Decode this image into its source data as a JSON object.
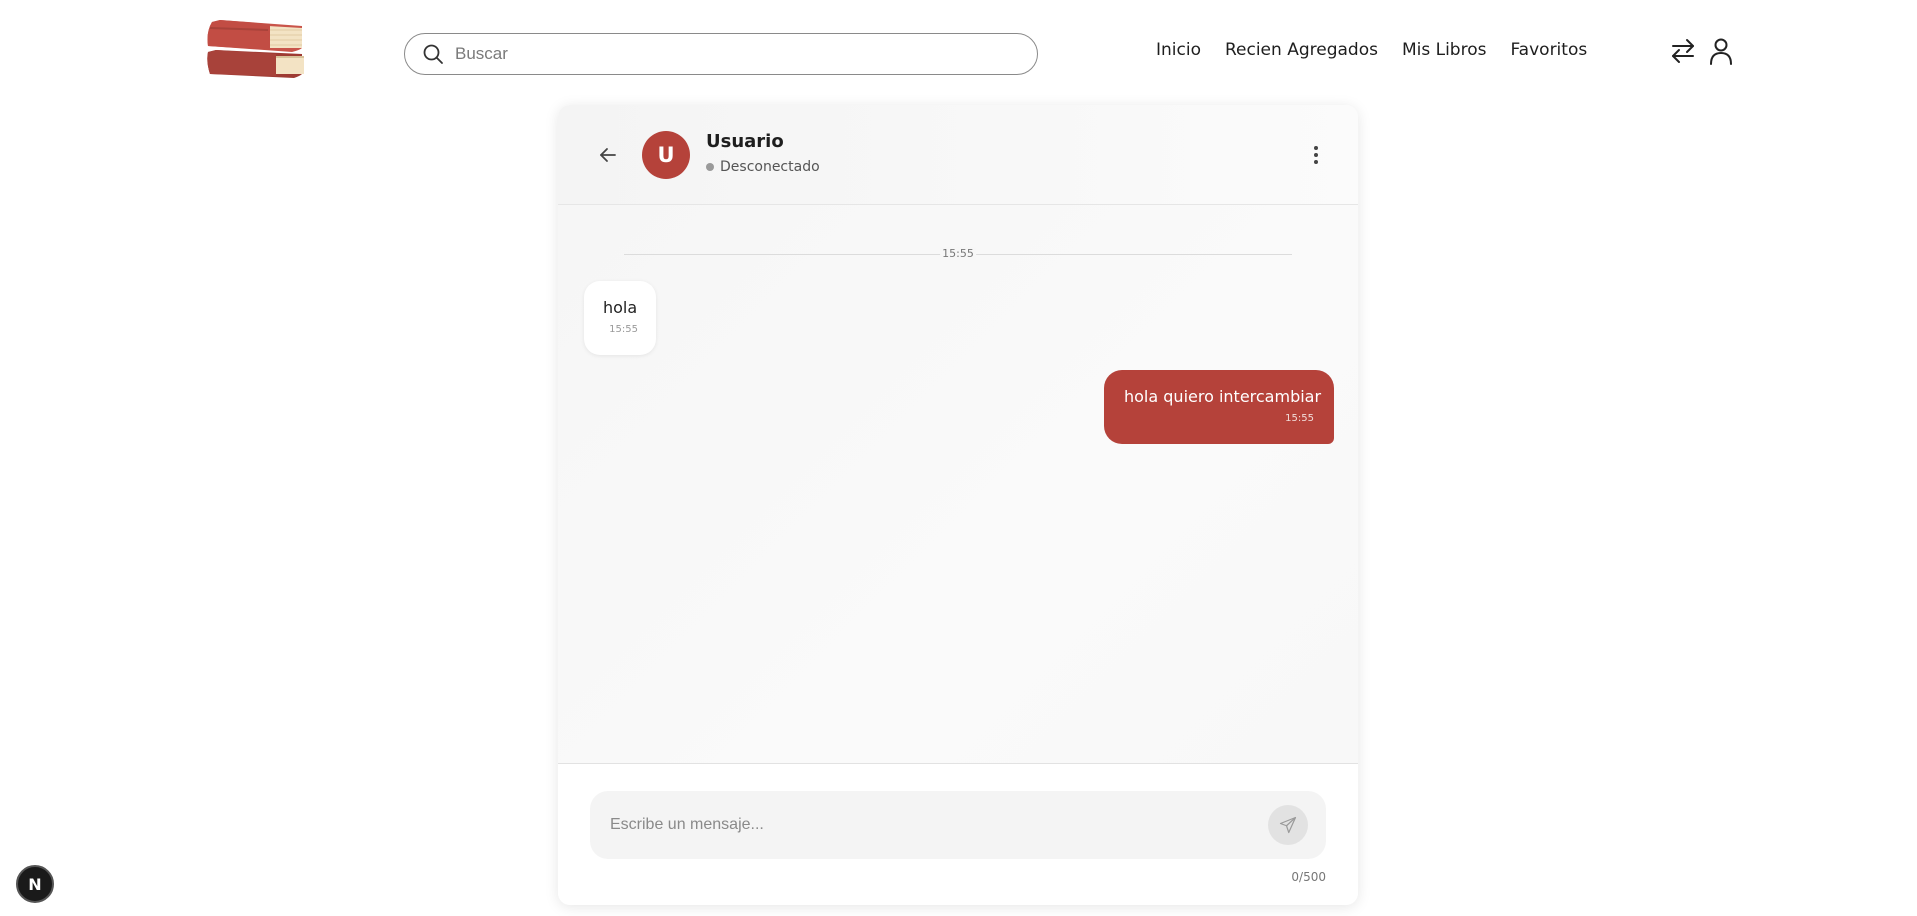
{
  "header": {
    "search_placeholder": "Buscar",
    "nav": [
      "Inicio",
      "Recien Agregados",
      "Mis Libros",
      "Favoritos"
    ]
  },
  "chat": {
    "contact": {
      "initial": "U",
      "name": "Usuario",
      "status": "Desconectado"
    },
    "divider_time": "15:55",
    "messages": [
      {
        "direction": "in",
        "text": "hola",
        "time": "15:55"
      },
      {
        "direction": "out",
        "text": "hola quiero intercambiar",
        "time": "15:55"
      }
    ],
    "composer": {
      "placeholder": "Escribe un mensaje...",
      "value": "",
      "char_count": "0/500"
    }
  },
  "colors": {
    "accent": "#b5423a",
    "book_light": "#c9544a",
    "book_dark": "#9e3b33",
    "pages": "#f3e3c4"
  },
  "dev_badge": "N"
}
